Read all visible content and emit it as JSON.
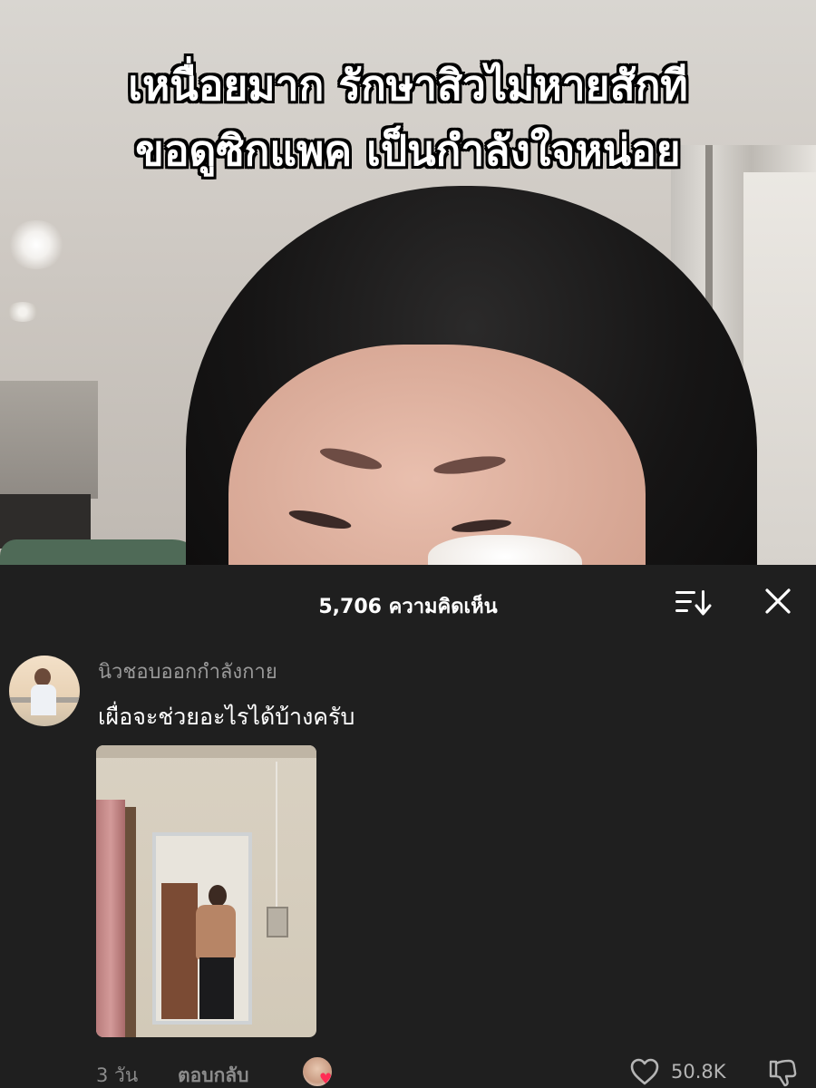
{
  "video": {
    "caption_lines": [
      "เหนื่อยมาก รักษาสิวไม่หายสักที",
      "ขอดูซิกแพค เป็นกำลังใจหน่อย"
    ]
  },
  "comments_sheet": {
    "header": {
      "count_label": "5,706 ความคิดเห็น",
      "sort_icon": "sort-icon",
      "close_icon": "close-icon"
    },
    "comments": [
      {
        "username": "นิวชอบออกกำลังกาย",
        "text": "เผื่อจะช่วยอะไรได้บ้างครับ",
        "attachment": "photo",
        "time": "3 วัน",
        "reply_label": "ตอบกลับ",
        "creator_liked": true,
        "likes": "50.8K"
      }
    ]
  },
  "colors": {
    "sheet_background": "#1f1f1f",
    "text_primary": "#ffffff",
    "text_secondary": "#9a9a9a",
    "creator_heart": "#ff2d55"
  }
}
